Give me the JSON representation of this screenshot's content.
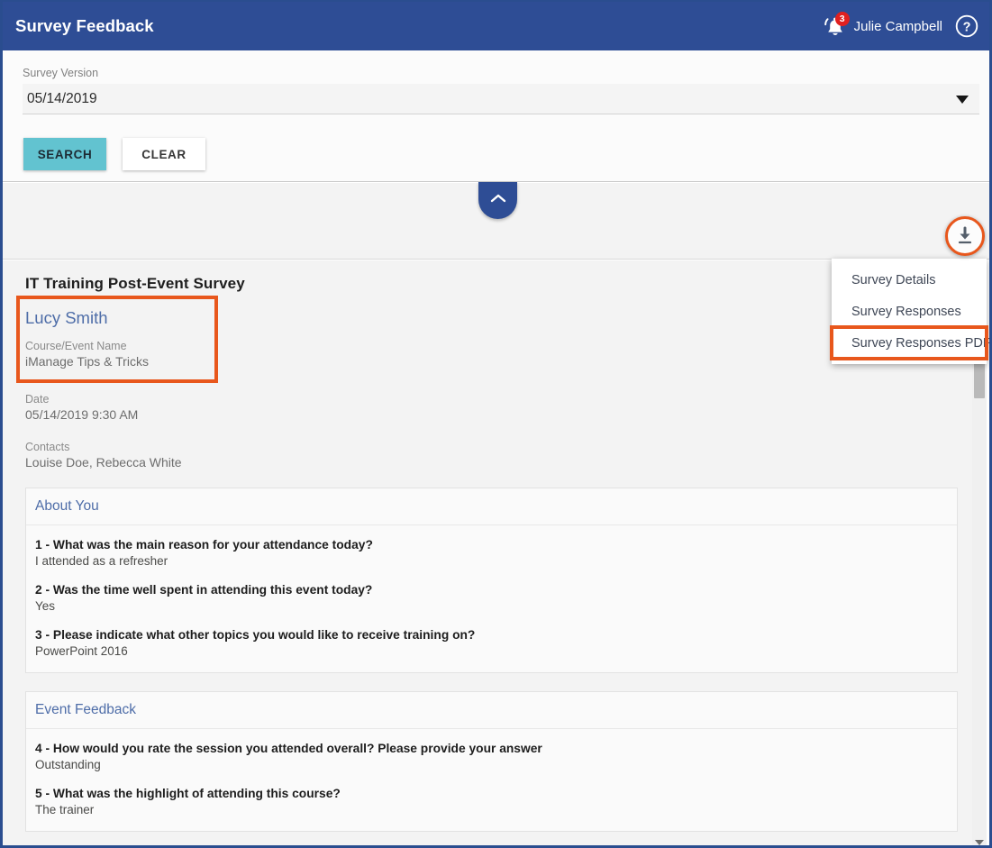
{
  "header": {
    "title": "Survey Feedback",
    "notification_count": "3",
    "user_name": "Julie Campbell",
    "bell_icon": "bell-icon",
    "help_icon": "help-circle-icon",
    "background_color": "#2e4d95"
  },
  "search": {
    "field_label": "Survey Version",
    "selected_value": "05/14/2019",
    "search_label": "SEARCH",
    "clear_label": "CLEAR",
    "search_color": "#62c3d0",
    "caret_icon": "chevron-down-icon"
  },
  "collapse": {
    "icon": "chevron-up-icon"
  },
  "download": {
    "icon": "download-icon",
    "highlight_color": "#e8571c"
  },
  "menu": {
    "items": [
      {
        "label": "Survey Details",
        "highlighted": false
      },
      {
        "label": "Survey Responses",
        "highlighted": false
      },
      {
        "label": "Survey Responses PDF",
        "highlighted": true
      }
    ]
  },
  "survey": {
    "title": "IT Training Post-Event Survey",
    "respondent": "Lucy Smith",
    "course_label": "Course/Event Name",
    "course_value": "iManage Tips & Tricks",
    "date_label": "Date",
    "date_value": "05/14/2019 9:30 AM",
    "contacts_label": "Contacts",
    "contacts_value": "Louise Doe, Rebecca White"
  },
  "sections": [
    {
      "title": "About You",
      "questions": [
        {
          "q": "1 - What was the main reason for your attendance today?",
          "a": "I attended as a refresher"
        },
        {
          "q": "2 - Was the time well spent in attending this event today?",
          "a": "Yes"
        },
        {
          "q": "3 - Please indicate what other topics you would like to receive training on?",
          "a": "PowerPoint 2016"
        }
      ]
    },
    {
      "title": "Event Feedback",
      "questions": [
        {
          "q": "4 - How would you rate the session you attended overall? Please provide your answer",
          "a": "Outstanding"
        },
        {
          "q": "5 - What was the highlight of attending this course?",
          "a": "The trainer"
        }
      ]
    }
  ]
}
